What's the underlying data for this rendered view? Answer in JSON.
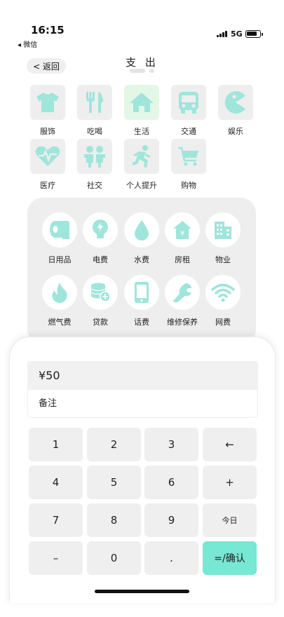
{
  "status_bar": {
    "time": "16:15",
    "back_app": "◂ 微信",
    "network": "5G"
  },
  "header": {
    "back_label": "< 返回",
    "title": "支 出"
  },
  "colors": {
    "icon_mint": "#9fe5db",
    "accent": "#78e7d3",
    "selected_tile": "#e3f7e6"
  },
  "categories": [
    {
      "label": "服饰",
      "icon": "tshirt-icon"
    },
    {
      "label": "吃喝",
      "icon": "utensils-icon"
    },
    {
      "label": "生活",
      "icon": "home-icon",
      "selected": true
    },
    {
      "label": "交通",
      "icon": "bus-icon"
    },
    {
      "label": "娱乐",
      "icon": "pacman-icon"
    },
    {
      "label": "医疗",
      "icon": "heartbeat-icon"
    },
    {
      "label": "社交",
      "icon": "people-icon"
    },
    {
      "label": "个人提升",
      "icon": "runner-icon"
    },
    {
      "label": "购物",
      "icon": "cart-icon"
    }
  ],
  "subcategories": [
    {
      "label": "日用品",
      "icon": "tissue-roll-icon"
    },
    {
      "label": "电费",
      "icon": "lightbulb-icon"
    },
    {
      "label": "水费",
      "icon": "water-drop-icon"
    },
    {
      "label": "房租",
      "icon": "house-yen-icon"
    },
    {
      "label": "物业",
      "icon": "building-icon"
    },
    {
      "label": "燃气费",
      "icon": "flame-icon"
    },
    {
      "label": "贷款",
      "icon": "coins-icon"
    },
    {
      "label": "话费",
      "icon": "phone-icon"
    },
    {
      "label": "维修保养",
      "icon": "wrench-icon"
    },
    {
      "label": "网费",
      "icon": "wifi-icon"
    }
  ],
  "entry": {
    "amount": "¥50",
    "note_placeholder": "备注"
  },
  "keypad": {
    "k1": "1",
    "k2": "2",
    "k3": "3",
    "backspace": "←",
    "k4": "4",
    "k5": "5",
    "k6": "6",
    "plus": "+",
    "k7": "7",
    "k8": "8",
    "k9": "9",
    "today": "今日",
    "minus": "–",
    "k0": "0",
    "dot": ".",
    "confirm": "=/确认"
  }
}
